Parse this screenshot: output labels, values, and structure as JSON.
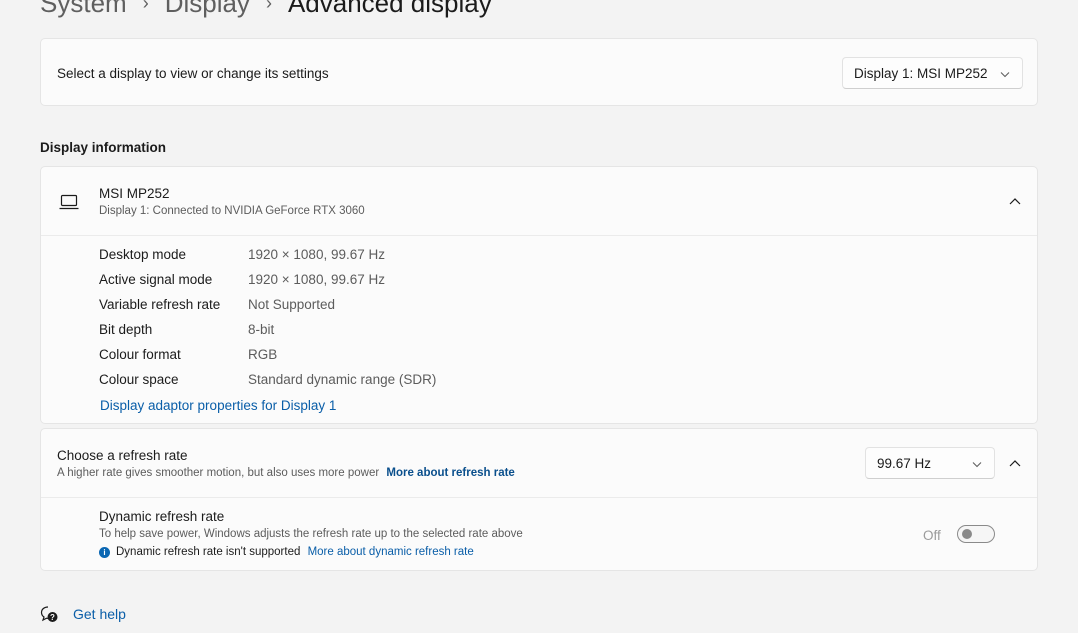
{
  "breadcrumb": {
    "items": [
      "System",
      "Display",
      "Advanced display"
    ],
    "separator": "›"
  },
  "select_display": {
    "label": "Select a display to view or change its settings",
    "dropdown_value": "Display 1: MSI MP252"
  },
  "display_information": {
    "heading": "Display information",
    "monitor_name": "MSI MP252",
    "monitor_subtitle": "Display 1: Connected to NVIDIA GeForce RTX 3060",
    "rows": [
      {
        "label": "Desktop mode",
        "value": "1920 × 1080, 99.67 Hz"
      },
      {
        "label": "Active signal mode",
        "value": "1920 × 1080, 99.67 Hz"
      },
      {
        "label": "Variable refresh rate",
        "value": "Not Supported"
      },
      {
        "label": "Bit depth",
        "value": "8-bit"
      },
      {
        "label": "Colour format",
        "value": "RGB"
      },
      {
        "label": "Colour space",
        "value": "Standard dynamic range (SDR)"
      }
    ],
    "adaptor_link": "Display adaptor properties for Display 1"
  },
  "refresh_rate": {
    "title": "Choose a refresh rate",
    "description": "A higher rate gives smoother motion, but also uses more power",
    "more_link": "More about refresh rate",
    "dropdown_value": "99.67 Hz",
    "dynamic": {
      "title": "Dynamic refresh rate",
      "description": "To help save power, Windows adjusts the refresh rate up to the selected rate above",
      "info_text": "Dynamic refresh rate isn't supported",
      "more_link": "More about dynamic refresh rate",
      "toggle_label": "Off",
      "toggle_on": false
    }
  },
  "help": {
    "label": "Get help"
  },
  "colors": {
    "accent_link": "#0a5ea8",
    "info_icon": "#0a67b3",
    "background": "#f3f3f3",
    "card": "#fbfbfb"
  },
  "icons": [
    "chevron-right-icon",
    "chevron-down-icon",
    "chevron-up-icon",
    "monitor-icon",
    "info-icon",
    "help-icon"
  ]
}
